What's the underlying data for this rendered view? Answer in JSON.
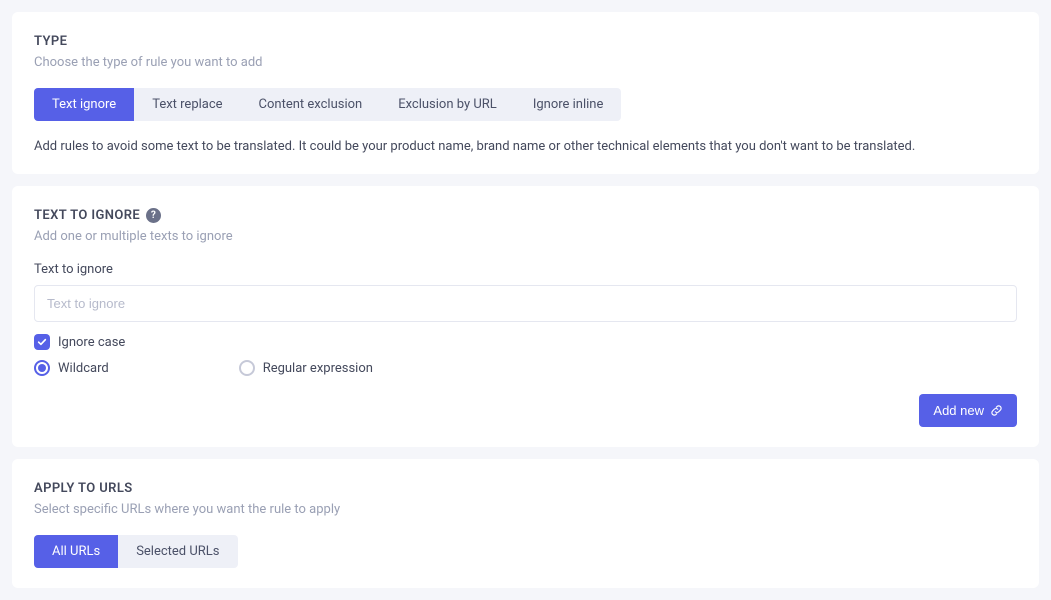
{
  "type_section": {
    "title": "TYPE",
    "subtitle": "Choose the type of rule you want to add",
    "tabs": [
      {
        "label": "Text ignore",
        "active": true
      },
      {
        "label": "Text replace",
        "active": false
      },
      {
        "label": "Content exclusion",
        "active": false
      },
      {
        "label": "Exclusion by URL",
        "active": false
      },
      {
        "label": "Ignore inline",
        "active": false
      }
    ],
    "description": "Add rules to avoid some text to be translated. It could be your product name, brand name or other technical elements that you don't want to be translated."
  },
  "ignore_section": {
    "title": "TEXT TO IGNORE",
    "subtitle": "Add one or multiple texts to ignore",
    "field_label": "Text to ignore",
    "placeholder": "Text to ignore",
    "ignore_case_label": "Ignore case",
    "wildcard_label": "Wildcard",
    "regex_label": "Regular expression",
    "add_button": "Add new"
  },
  "apply_section": {
    "title": "APPLY TO URLS",
    "subtitle": "Select specific URLs where you want the rule to apply",
    "tabs": [
      {
        "label": "All URLs",
        "active": true
      },
      {
        "label": "Selected URLs",
        "active": false
      }
    ]
  }
}
